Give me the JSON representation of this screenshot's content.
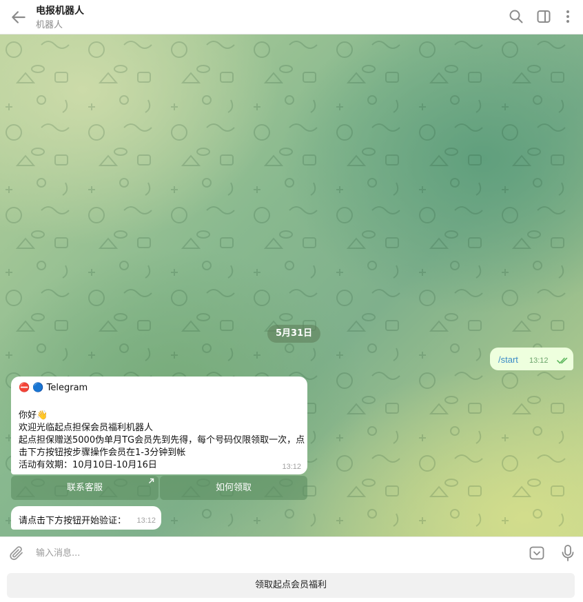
{
  "header": {
    "title": "电报机器人",
    "subtitle": "机器人"
  },
  "chat": {
    "date_label": "5月31日",
    "outgoing": {
      "text": "/start",
      "time": "13:12"
    },
    "incoming": {
      "lines": [
        "⛔ 🔵 Telegram",
        "你好👋",
        "欢迎光临起点担保会员福利机器人",
        "起点担保赠送5000伪单月TG会员先到先得，每个号码仅限领取一次，点",
        "击下方按钮按步骤操作会员在1-3分钟到帐",
        "活动有效期：10月10日-10月16日"
      ],
      "time": "13:12"
    },
    "inline_buttons": [
      "联系客服",
      "如何领取"
    ],
    "incoming2": {
      "text": "请点击下方按钮开始验证：",
      "time": "13:12"
    }
  },
  "composer": {
    "placeholder": "输入消息..."
  },
  "reply_keyboard": {
    "button_label": "领取起点会员福利"
  },
  "colors": {
    "accent": "#3a8bc6",
    "out_bubble": "#eeffde",
    "in_bubble": "#ffffff"
  },
  "icons": [
    "back-arrow-icon",
    "search-icon",
    "sidebar-toggle-icon",
    "more-vertical-icon",
    "attach-icon",
    "keyboard-icon",
    "microphone-icon",
    "double-check-icon",
    "external-link-icon"
  ]
}
